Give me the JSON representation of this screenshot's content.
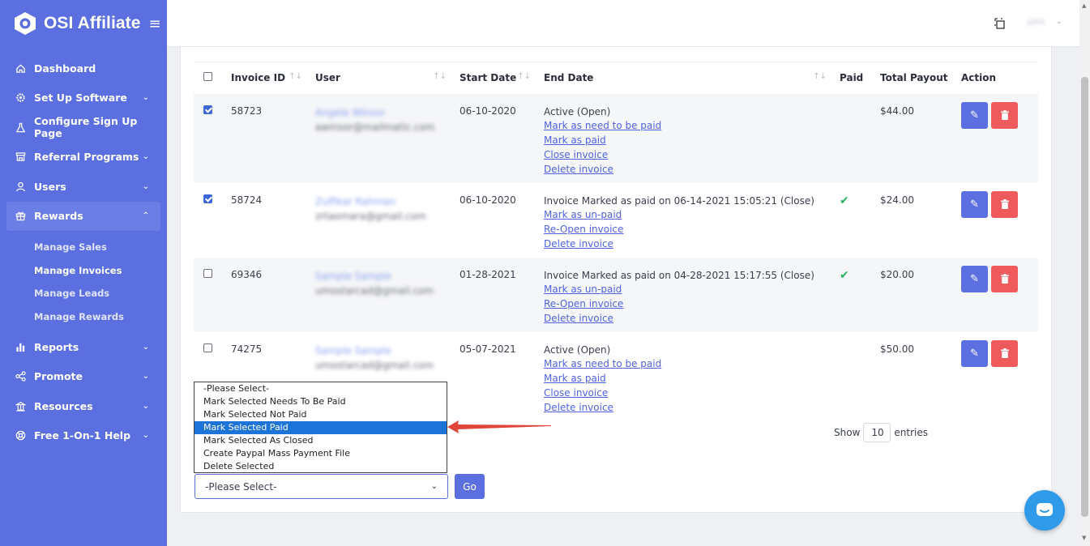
{
  "brand": {
    "name": "OSI Affiliate"
  },
  "user": {
    "name": "John"
  },
  "colors": {
    "sidebar": "#5b6fe0",
    "accent": "#5b6fe0",
    "danger": "#ef5a5d",
    "success": "#28b463",
    "select_highlight": "#1e73d8",
    "link": "#4f63e0"
  },
  "nav": [
    {
      "label": "Dashboard",
      "icon": "home-icon",
      "expandable": false
    },
    {
      "label": "Set Up Software",
      "icon": "gear-icon",
      "expandable": true
    },
    {
      "label": "Configure Sign Up Page",
      "icon": "flask-icon",
      "expandable": false
    },
    {
      "label": "Referral Programs",
      "icon": "store-icon",
      "expandable": true
    },
    {
      "label": "Users",
      "icon": "user-icon",
      "expandable": true
    },
    {
      "label": "Rewards",
      "icon": "gift-icon",
      "expandable": true,
      "active": true,
      "children": [
        "Manage Sales",
        "Manage Invoices",
        "Manage Leads",
        "Manage Rewards"
      ]
    },
    {
      "label": "Reports",
      "icon": "bar-chart-icon",
      "expandable": true
    },
    {
      "label": "Promote",
      "icon": "share-icon",
      "expandable": true
    },
    {
      "label": "Resources",
      "icon": "bank-icon",
      "expandable": true
    },
    {
      "label": "Free 1-On-1 Help",
      "icon": "support-icon",
      "expandable": true
    }
  ],
  "table": {
    "columns": [
      "Invoice ID",
      "User",
      "Start Date",
      "End Date",
      "Paid",
      "Total Payout",
      "Action"
    ],
    "rows": [
      {
        "checked": true,
        "invoice_id": "58723",
        "user_name": "Angela Winsor",
        "user_email": "awinsor@mailmatic.com",
        "start_date": "06-10-2020",
        "end": [
          "Active (Open)",
          "Mark as need to be paid",
          "Mark as paid",
          "Close invoice",
          "Delete invoice"
        ],
        "paid": false,
        "payout": "$44.00"
      },
      {
        "checked": true,
        "invoice_id": "58724",
        "user_name": "Zulfikar Rahman",
        "user_email": "zrtaomara@gmail.com",
        "start_date": "06-10-2020",
        "end": [
          "Invoice Marked as paid on 06-14-2021 15:05:21 (Close)",
          "Mark as un-paid",
          "Re-Open invoice",
          "Delete invoice"
        ],
        "paid": true,
        "payout": "$24.00"
      },
      {
        "checked": false,
        "invoice_id": "69346",
        "user_name": "Sample Sample",
        "user_email": "umostarcad@gmail.com",
        "start_date": "01-28-2021",
        "end": [
          "Invoice Marked as paid on 04-28-2021 15:17:55 (Close)",
          "Mark as un-paid",
          "Re-Open invoice",
          "Delete invoice"
        ],
        "paid": true,
        "payout": "$20.00"
      },
      {
        "checked": false,
        "invoice_id": "74275",
        "user_name": "Sample Sample",
        "user_email": "umostarcad@gmail.com",
        "start_date": "05-07-2021",
        "end": [
          "Active (Open)",
          "Mark as need to be paid",
          "Mark as paid",
          "Close invoice",
          "Delete invoice"
        ],
        "paid": false,
        "payout": "$50.00"
      }
    ]
  },
  "entries": {
    "show": "Show",
    "value": "10",
    "suffix": "entries"
  },
  "bulk": {
    "selected": "-Please Select-",
    "go": "Go",
    "options": [
      "-Please Select-",
      "Mark Selected Needs To Be Paid",
      "Mark Selected Not Paid",
      "Mark Selected Paid",
      "Mark Selected As Closed",
      "Create Paypal Mass Payment File",
      "Delete Selected"
    ],
    "highlighted": "Mark Selected Paid"
  }
}
